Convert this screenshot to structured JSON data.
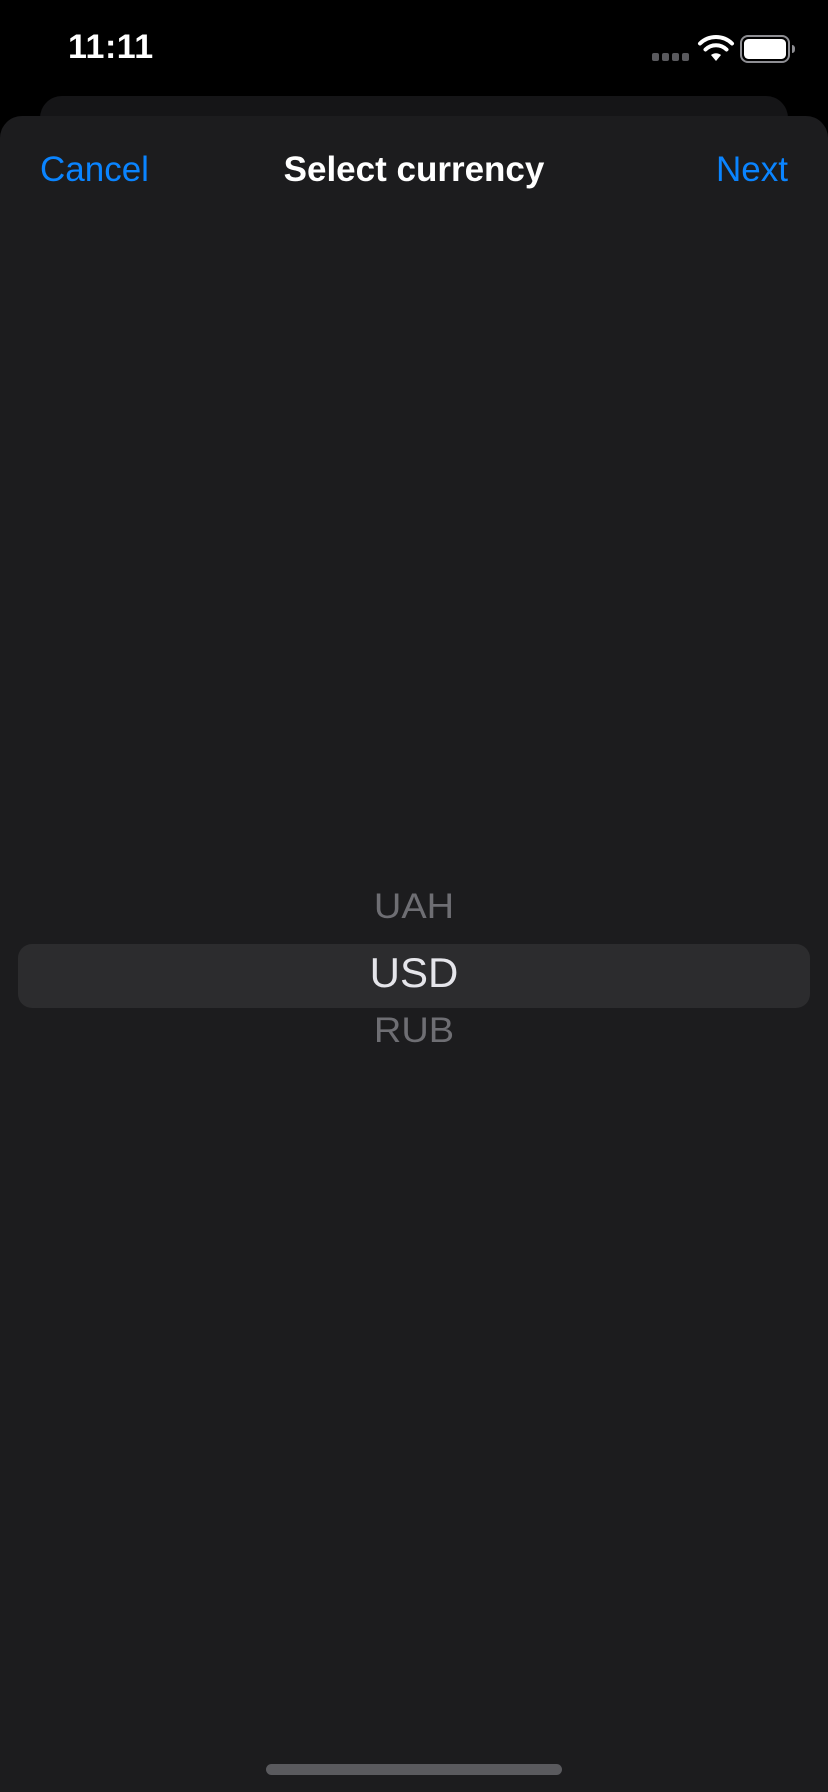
{
  "status_bar": {
    "time": "11:11",
    "icons": [
      "cellular-signal-icon",
      "wifi-icon",
      "battery-icon"
    ]
  },
  "sheet": {
    "nav": {
      "cancel_label": "Cancel",
      "title": "Select currency",
      "next_label": "Next"
    },
    "picker": {
      "options": [
        "UAH",
        "USD",
        "RUB"
      ],
      "selected": "USD"
    }
  },
  "colors": {
    "accent": "#0a84ff",
    "sheet_background": "#1c1c1e",
    "picker_highlight": "#2c2c2e",
    "background": "#000000"
  }
}
